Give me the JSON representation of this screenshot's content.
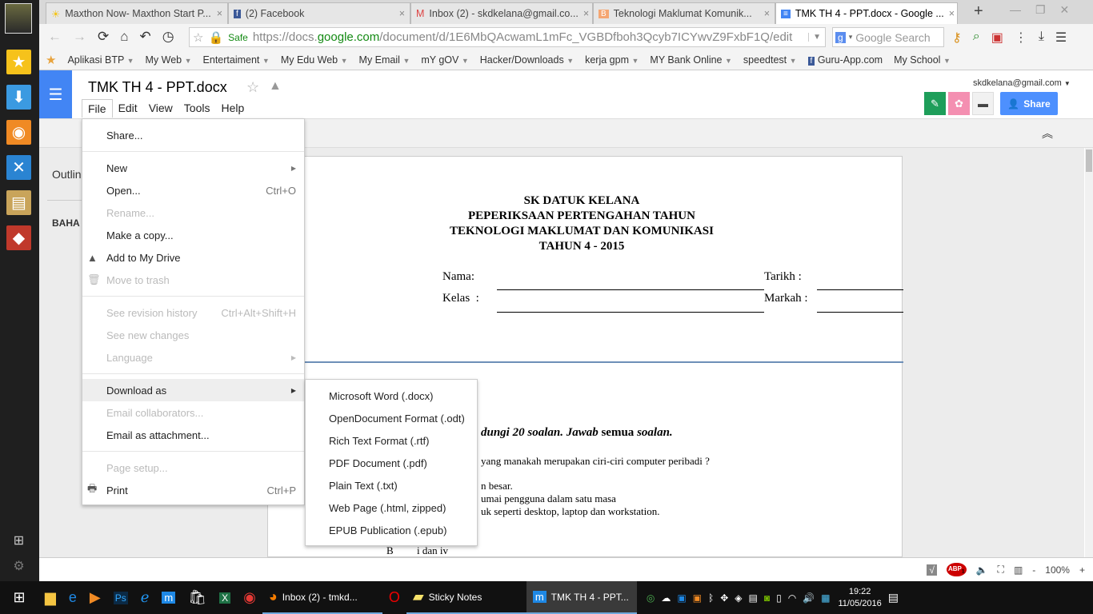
{
  "browser": {
    "tabs": [
      {
        "label": "Maxthon Now- Maxthon Start P...",
        "icon": "sun-icon"
      },
      {
        "label": "(2) Facebook",
        "icon": "facebook-icon"
      },
      {
        "label": "Inbox (2) - skdkelana@gmail.co...",
        "icon": "gmail-icon"
      },
      {
        "label": "Teknologi Maklumat Komunik...",
        "icon": "blogger-icon"
      },
      {
        "label": "TMK TH 4 - PPT.docx - Google ...",
        "icon": "docs-icon",
        "active": true
      }
    ],
    "close": "×",
    "new_tab": "+",
    "safe_label": "Safe",
    "url_prefix": "https://docs.",
    "url_domain": "google.com",
    "url_rest": "/document/d/1E6MbQAcwamL1mFc_VGBDfboh3Qcyb7ICYwvZ9FxbF1Q/edit",
    "search_placeholder": "Google Search",
    "bookmarks": [
      "Aplikasi BTP",
      "My Web",
      "Entertaiment",
      "My Edu Web",
      "My Email",
      "mY gOV",
      "Hacker/Downloads",
      "kerja gpm",
      "MY Bank Online",
      "speedtest",
      "Guru-App.com",
      "My School"
    ]
  },
  "docs": {
    "title": "TMK TH 4 - PPT.docx",
    "account": "skdkelana@gmail.com",
    "share": "Share",
    "menus": [
      "File",
      "Edit",
      "View",
      "Tools",
      "Help"
    ],
    "outline_label": "Outlin",
    "outline_item": "BAHA"
  },
  "file_menu": [
    {
      "label": "Share...",
      "enabled": true
    },
    {
      "label": "New",
      "enabled": true,
      "submenu": true
    },
    {
      "label": "Open...",
      "shortcut": "Ctrl+O",
      "enabled": true
    },
    {
      "label": "Rename...",
      "enabled": false
    },
    {
      "label": "Make a copy...",
      "enabled": true
    },
    {
      "label": "Add to My Drive",
      "enabled": true,
      "icon": "drive-add-icon"
    },
    {
      "label": "Move to trash",
      "enabled": false,
      "icon": "trash-icon"
    },
    {
      "label": "See revision history",
      "shortcut": "Ctrl+Alt+Shift+H",
      "enabled": false
    },
    {
      "label": "See new changes",
      "enabled": false
    },
    {
      "label": "Language",
      "enabled": false,
      "submenu": true
    },
    {
      "label": "Download as",
      "enabled": true,
      "submenu": true,
      "highlighted": true
    },
    {
      "label": "Email collaborators...",
      "enabled": false
    },
    {
      "label": "Email as attachment...",
      "enabled": true
    },
    {
      "label": "Page setup...",
      "enabled": false
    },
    {
      "label": "Print",
      "shortcut": "Ctrl+P",
      "enabled": true,
      "icon": "print-icon"
    }
  ],
  "download_menu": [
    "Microsoft Word (.docx)",
    "OpenDocument Format (.odt)",
    "Rich Text Format (.rtf)",
    "PDF Document (.pdf)",
    "Plain Text (.txt)",
    "Web Page (.html, zipped)",
    "EPUB Publication (.epub)"
  ],
  "document": {
    "heading": [
      "SK DATUK KELANA",
      "PEPERIKSAAN PERTENGAHAN TAHUN",
      "TEKNOLOGI MAKLUMAT DAN KOMUNIKASI",
      "TAHUN 4 - 2015"
    ],
    "nama": "Nama:",
    "tarikh": "Tarikh :",
    "kelas": "Kelas  :",
    "markah": "Markah :",
    "instr_a": "dungi 20 ",
    "instr_b": "soalan. Jawab ",
    "instr_c": "semua ",
    "instr_d": "soalan.",
    "q1": "yang manakah merupakan ciri-ciri computer peribadi ?",
    "l1": "n besar.",
    "l2": "umai pengguna dalam satu masa",
    "l3": "uk seperti desktop, laptop dan workstation.",
    "optB": "B",
    "optB_text": "i dan iv"
  },
  "status": {
    "zoom": "100%",
    "minus": "-",
    "plus": "+",
    "abp_count": "1"
  },
  "taskbar": {
    "items": [
      {
        "label": "Inbox (2) - tmkd..."
      },
      {
        "label": "Sticky Notes"
      },
      {
        "label": "TMK TH 4 - PPT..."
      }
    ],
    "time": "19:22",
    "date": "11/05/2016"
  }
}
